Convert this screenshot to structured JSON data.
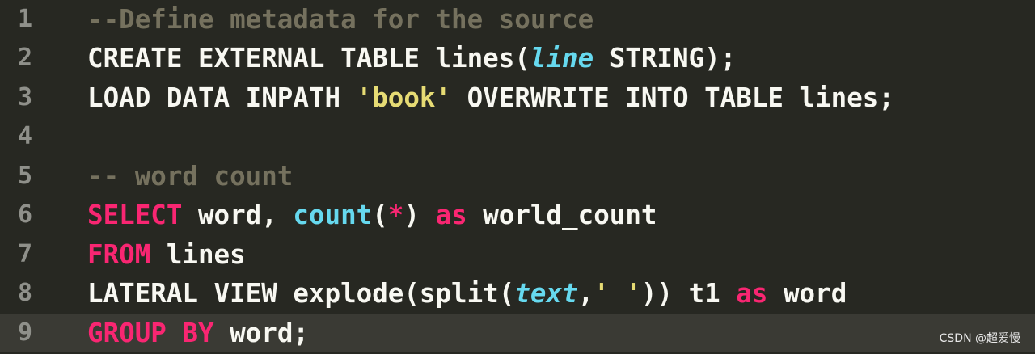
{
  "editor": {
    "lines": [
      {
        "number": "1",
        "tokens": [
          {
            "text": "--Define metadata for the source",
            "kind": "comment"
          }
        ]
      },
      {
        "number": "2",
        "tokens": [
          {
            "text": "CREATE EXTERNAL TABLE lines(",
            "kind": "plain"
          },
          {
            "text": "line",
            "kind": "param"
          },
          {
            "text": " STRING);",
            "kind": "plain"
          }
        ]
      },
      {
        "number": "3",
        "tokens": [
          {
            "text": "LOAD DATA INPATH ",
            "kind": "plain"
          },
          {
            "text": "'book'",
            "kind": "string"
          },
          {
            "text": " OVERWRITE INTO TABLE lines;",
            "kind": "plain"
          }
        ]
      },
      {
        "number": "4",
        "tokens": []
      },
      {
        "number": "5",
        "tokens": [
          {
            "text": "-- word count",
            "kind": "comment"
          }
        ]
      },
      {
        "number": "6",
        "tokens": [
          {
            "text": "SELECT",
            "kind": "keyword"
          },
          {
            "text": " word, ",
            "kind": "plain"
          },
          {
            "text": "count",
            "kind": "func"
          },
          {
            "text": "(",
            "kind": "plain"
          },
          {
            "text": "*",
            "kind": "keyword"
          },
          {
            "text": ") ",
            "kind": "plain"
          },
          {
            "text": "as",
            "kind": "keyword"
          },
          {
            "text": " world_count",
            "kind": "plain"
          }
        ]
      },
      {
        "number": "7",
        "tokens": [
          {
            "text": "FROM",
            "kind": "keyword"
          },
          {
            "text": " lines",
            "kind": "plain"
          }
        ]
      },
      {
        "number": "8",
        "tokens": [
          {
            "text": "LATERAL VIEW explode(split(",
            "kind": "plain"
          },
          {
            "text": "text",
            "kind": "param"
          },
          {
            "text": ",",
            "kind": "plain"
          },
          {
            "text": "' '",
            "kind": "string"
          },
          {
            "text": ")) t1 ",
            "kind": "plain"
          },
          {
            "text": "as",
            "kind": "keyword"
          },
          {
            "text": " word",
            "kind": "plain"
          }
        ]
      },
      {
        "number": "9",
        "current": true,
        "tokens": [
          {
            "text": "GROUP BY",
            "kind": "keyword"
          },
          {
            "text": " word;",
            "kind": "plain"
          }
        ]
      }
    ]
  },
  "watermark": "CSDN @超爱慢",
  "colors": {
    "background": "#272822",
    "current_line": "#3a3a34",
    "gutter_text": "#8f908a",
    "plain": "#f8f8f2",
    "comment": "#75715e",
    "keyword": "#f92672",
    "function": "#66d9ef",
    "string": "#e6db74"
  }
}
